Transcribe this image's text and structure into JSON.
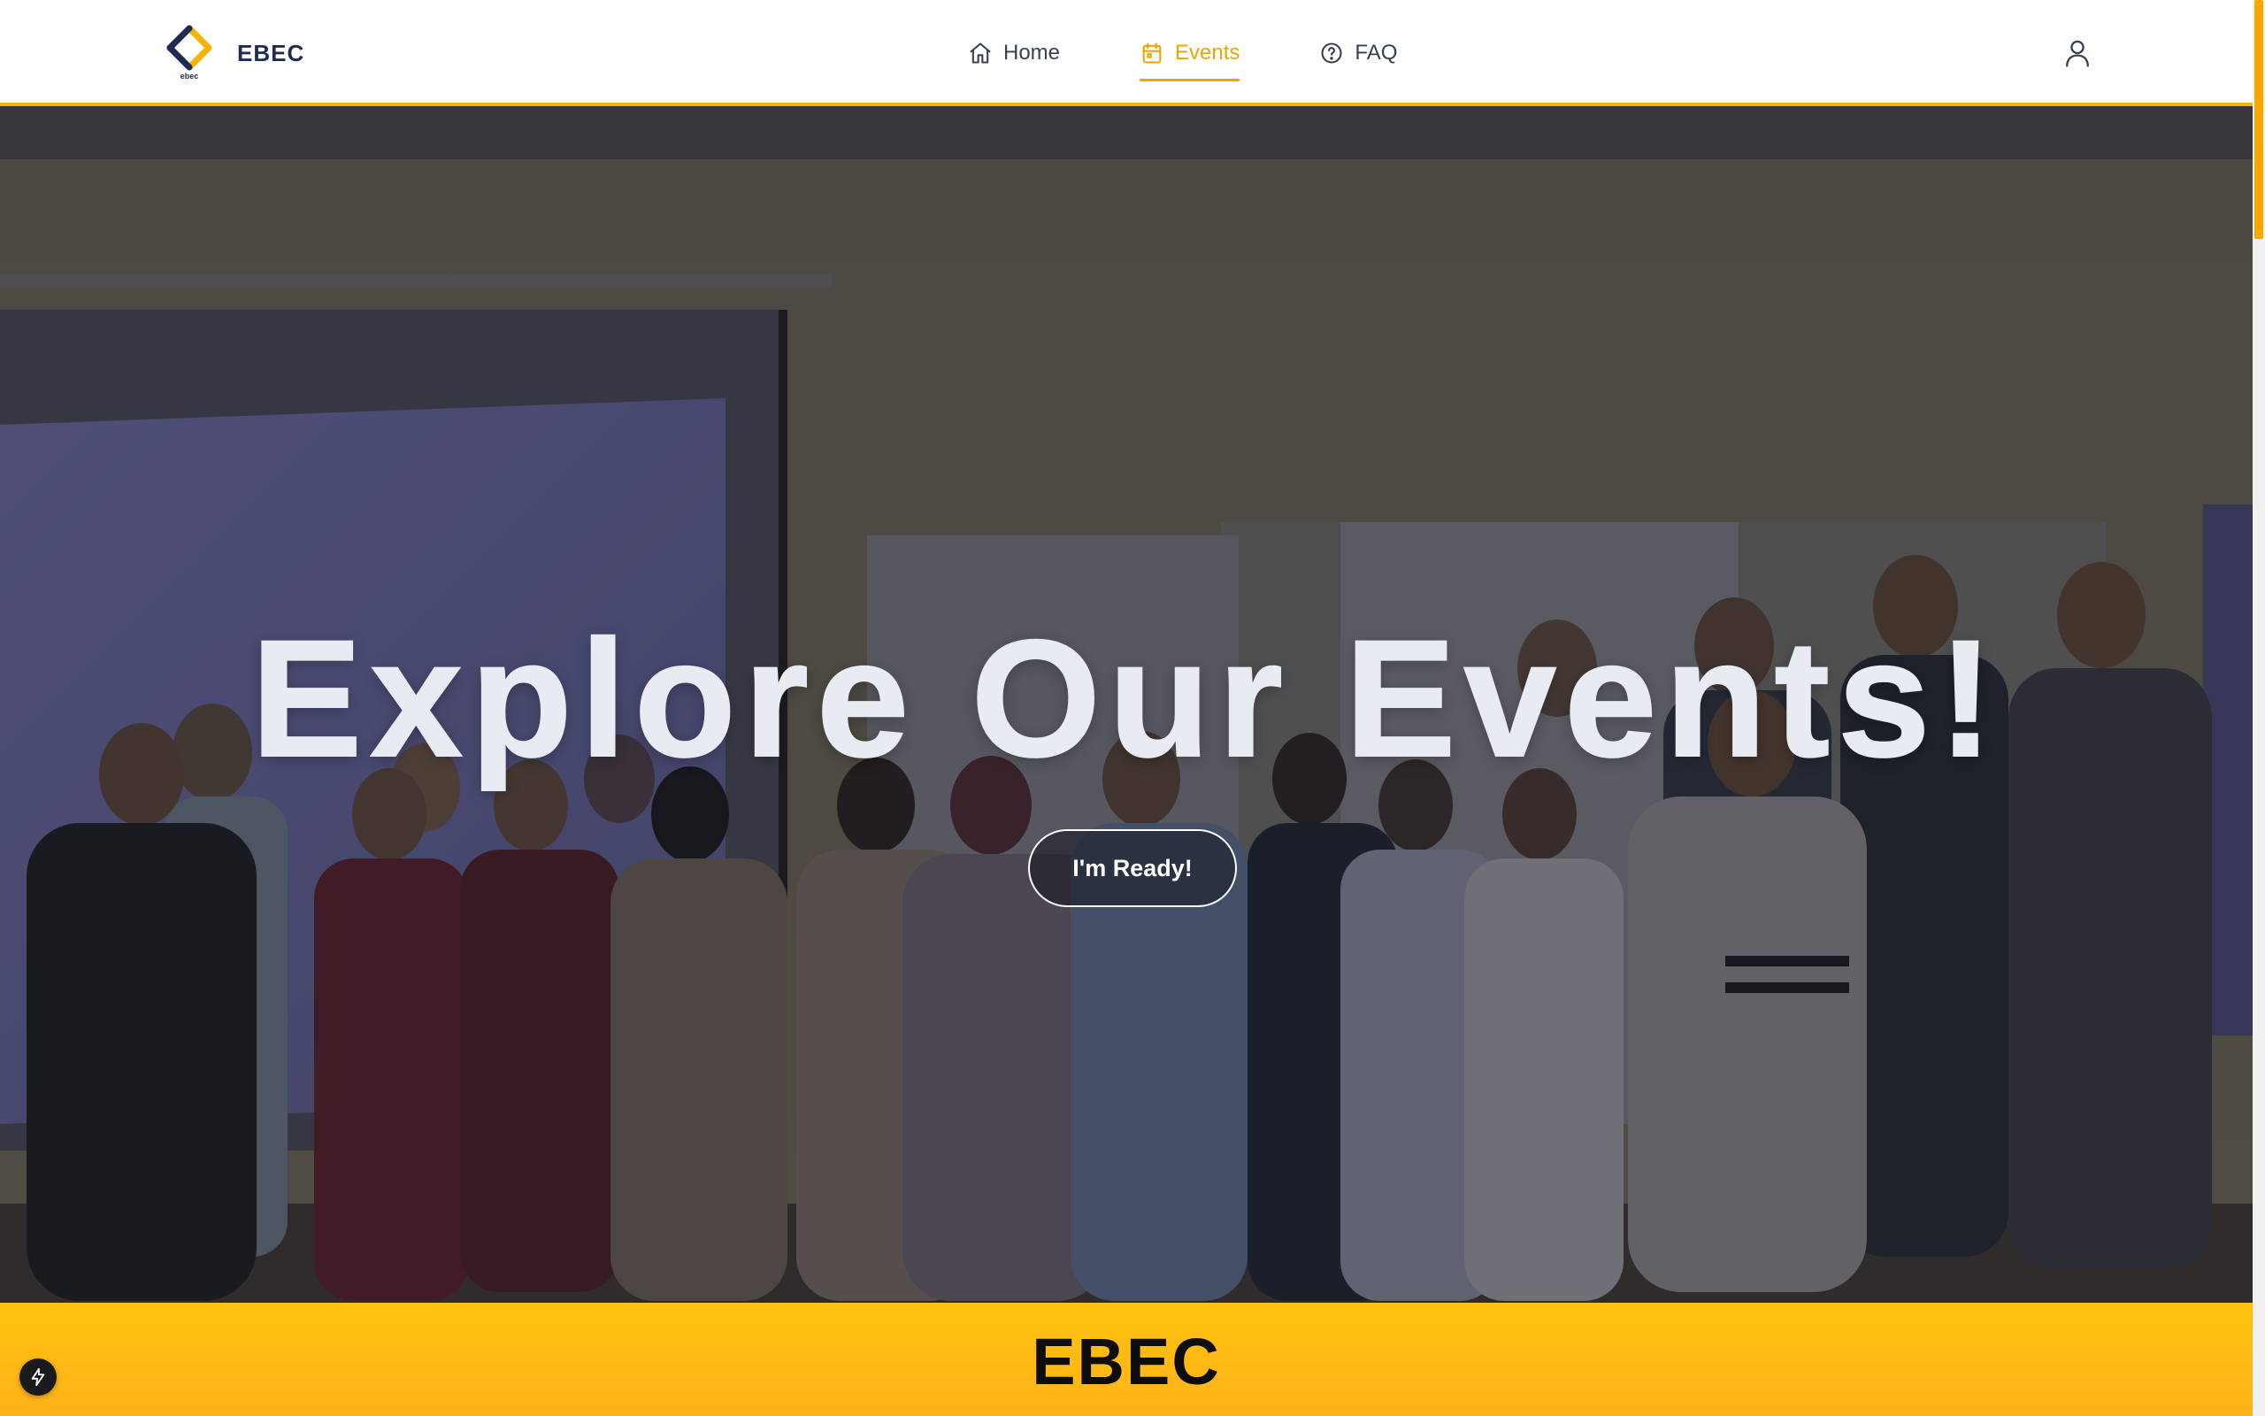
{
  "header": {
    "brand_name": "EBEC",
    "logo_caption": "ebec",
    "nav": [
      {
        "label": "Home",
        "icon": "home-icon",
        "active": false
      },
      {
        "label": "Events",
        "icon": "calendar-icon",
        "active": true
      },
      {
        "label": "FAQ",
        "icon": "help-circle-icon",
        "active": false
      }
    ],
    "account_icon": "user-icon"
  },
  "hero": {
    "title": "Explore Our Events!",
    "cta_label": "I'm Ready!",
    "background": "group photo of event participants"
  },
  "section": {
    "title": "EBEC"
  },
  "floating_button": {
    "icon": "bolt-icon"
  },
  "colors": {
    "accent": "#f4b400",
    "active_nav": "#e6a800",
    "brand_text": "#1f2a55",
    "band": "#ffc20f"
  }
}
